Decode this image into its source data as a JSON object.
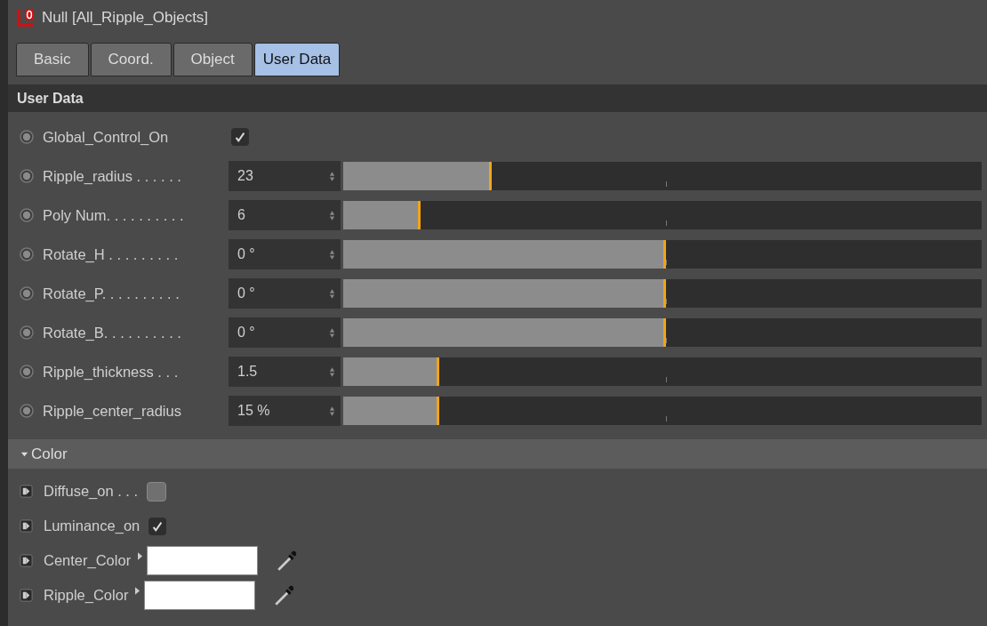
{
  "window": {
    "title": "Null [All_Ripple_Objects]"
  },
  "tabs": [
    {
      "label": "Basic",
      "selected": false
    },
    {
      "label": "Coord.",
      "selected": false
    },
    {
      "label": "Object",
      "selected": false
    },
    {
      "label": "User Data",
      "selected": true
    }
  ],
  "section": {
    "title": "User Data"
  },
  "params": [
    {
      "kind": "checkbox",
      "label": "Global_Control_On",
      "checked": true
    },
    {
      "kind": "slider",
      "label": "Ripple_radius . . . . . .",
      "value": "23",
      "level": 0.233
    },
    {
      "kind": "slider",
      "label": "Poly Num. . . . . . . . . .",
      "value": "6",
      "level": 0.121
    },
    {
      "kind": "slider",
      "label": "Rotate_H . . . . . . . . .",
      "value": "0 °",
      "level": 0.506
    },
    {
      "kind": "slider",
      "label": "Rotate_P. . . . . . . . . .",
      "value": "0 °",
      "level": 0.506
    },
    {
      "kind": "slider",
      "label": "Rotate_B. . . . . . . . . .",
      "value": "0 °",
      "level": 0.506
    },
    {
      "kind": "slider",
      "label": "Ripple_thickness . . .",
      "value": "1.5",
      "level": 0.151
    },
    {
      "kind": "slider",
      "label": "Ripple_center_radius",
      "value": "15 %",
      "level": 0.151
    }
  ],
  "group": {
    "title": "Color",
    "expanded": true,
    "params": [
      {
        "kind": "checkbox",
        "label": "Diffuse_on . . .",
        "checked": false
      },
      {
        "kind": "checkbox",
        "label": "Luminance_on",
        "checked": true
      },
      {
        "kind": "color",
        "label": "Center_Color",
        "color": "#ffffff"
      },
      {
        "kind": "color",
        "label": "Ripple_Color",
        "color": "#ffffff"
      }
    ]
  }
}
